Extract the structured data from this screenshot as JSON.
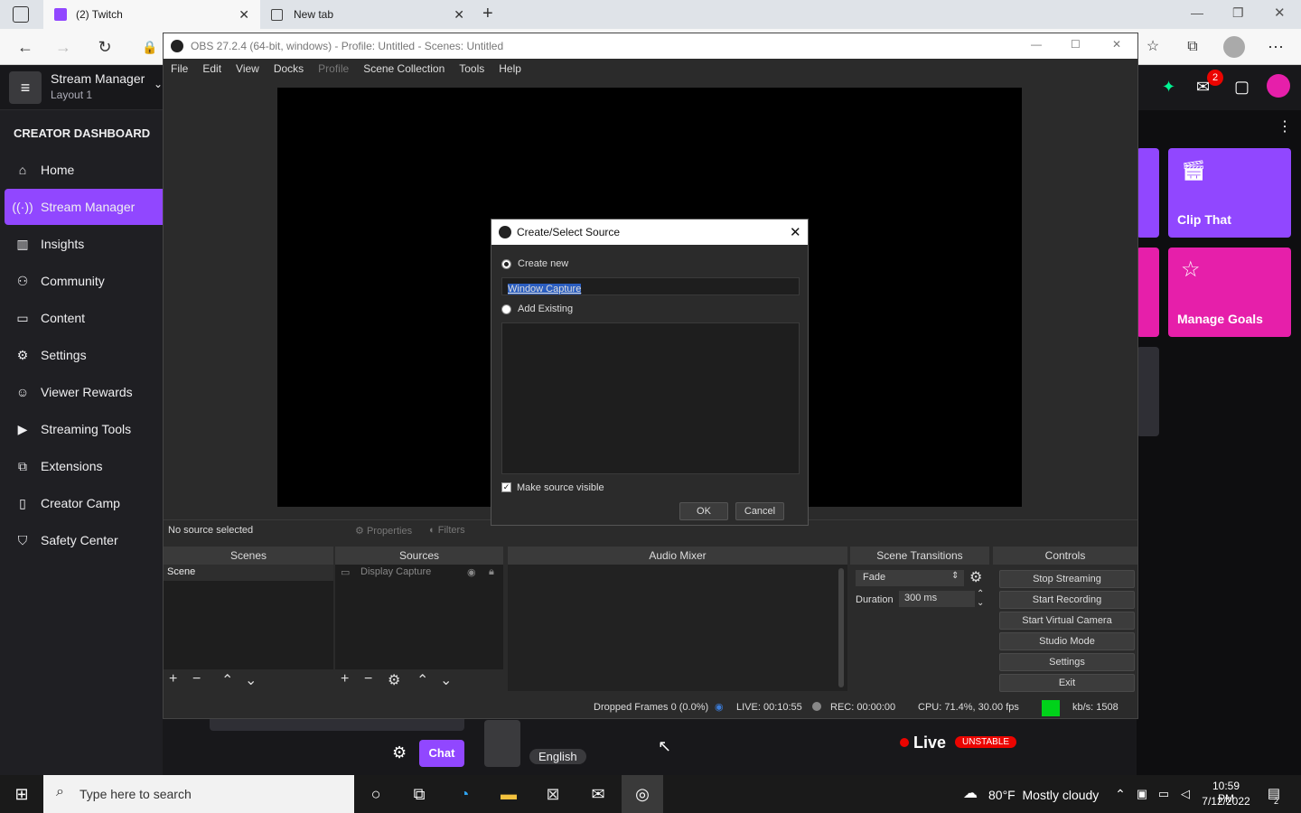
{
  "browser": {
    "tabs": [
      {
        "label": "(2) Twitch"
      },
      {
        "label": "New tab"
      }
    ],
    "add_tab": "+"
  },
  "twitch": {
    "header_title": "Stream Manager",
    "header_sub": "Layout 1",
    "section": "CREATOR DASHBOARD",
    "nav": [
      {
        "label": "Home",
        "icon": "home-icon"
      },
      {
        "label": "Stream Manager",
        "icon": "broadcast-icon"
      },
      {
        "label": "Insights",
        "icon": "chart-icon"
      },
      {
        "label": "Community",
        "icon": "community-icon"
      },
      {
        "label": "Content",
        "icon": "content-icon"
      },
      {
        "label": "Settings",
        "icon": "gear-icon"
      },
      {
        "label": "Viewer Rewards",
        "icon": "rewards-icon"
      },
      {
        "label": "Streaming Tools",
        "icon": "camera-icon"
      },
      {
        "label": "Extensions",
        "icon": "puzzle-icon"
      },
      {
        "label": "Creator Camp",
        "icon": "book-icon"
      },
      {
        "label": "Safety Center",
        "icon": "shield-icon"
      }
    ],
    "notif_count": "2",
    "tiles": [
      {
        "label": "Clip That"
      },
      {
        "label": "Manage Goals"
      }
    ],
    "bottom": {
      "chat": "Chat",
      "language": "English",
      "live": "Live",
      "unstable": "UNSTABLE"
    },
    "accent": "#9147ff"
  },
  "obs": {
    "title": "OBS 27.2.4 (64-bit, windows) - Profile: Untitled - Scenes: Untitled",
    "menu": [
      "File",
      "Edit",
      "View",
      "Docks",
      "Profile",
      "Scene Collection",
      "Tools",
      "Help"
    ],
    "no_source": "No source selected",
    "properties": "Properties",
    "filters": "Filters",
    "docks": {
      "scenes": "Scenes",
      "sources": "Sources",
      "mixer": "Audio Mixer",
      "transitions": "Scene Transitions",
      "controls": "Controls"
    },
    "scene_item": "Scene",
    "source_item": "Display Capture",
    "transition": "Fade",
    "duration_label": "Duration",
    "duration_value": "300 ms",
    "controls": [
      "Stop Streaming",
      "Start Recording",
      "Start Virtual Camera",
      "Studio Mode",
      "Settings",
      "Exit"
    ],
    "status": {
      "dropped": "Dropped Frames 0 (0.0%)",
      "live": "LIVE: 00:10:55",
      "rec": "REC: 00:00:00",
      "cpu": "CPU: 71.4%, 30.00 fps",
      "kbs": "kb/s: 1508"
    }
  },
  "dialog": {
    "title": "Create/Select Source",
    "create_new": "Create new",
    "name_value": "Window Capture",
    "add_existing": "Add Existing",
    "make_visible": "Make source visible",
    "ok": "OK",
    "cancel": "Cancel"
  },
  "taskbar": {
    "search_placeholder": "Type here to search",
    "weather": "80°F  Mostly cloudy",
    "time": "10:59 PM",
    "date": "7/12/2022",
    "notif": "2"
  }
}
